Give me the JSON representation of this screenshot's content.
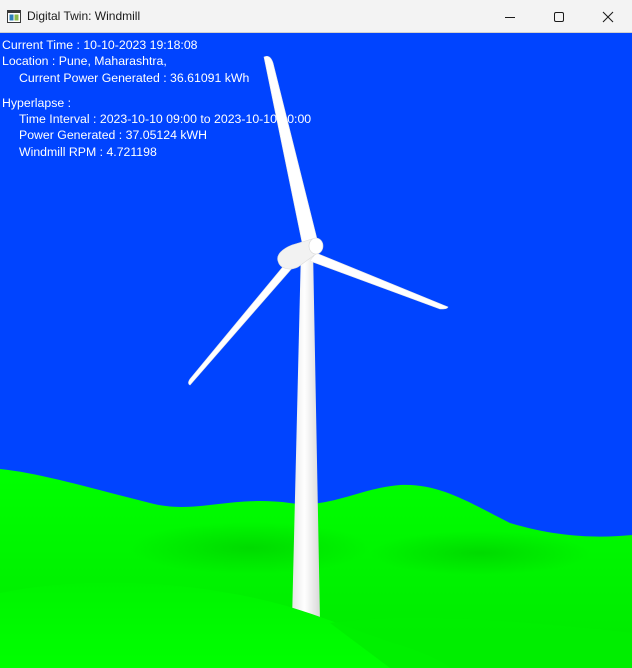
{
  "window": {
    "title": "Digital Twin: Windmill",
    "app_icon": "app-window-icon",
    "controls": {
      "minimize": "minimize-icon",
      "maximize": "maximize-icon",
      "close": "close-icon"
    }
  },
  "scene": {
    "sky_color": "#0044ff",
    "grass_color": "#00ee00",
    "turbine_color": "#ffffff"
  },
  "hud": {
    "current_time": "Current Time : 10-10-2023 19:18:08",
    "location": "Location : Pune, Maharashtra,",
    "current_power": "Current Power Generated : 36.61091 kWh",
    "hyperlapse_heading": "Hyperlapse :",
    "time_interval": "Time Interval : 2023-10-10 09:00 to 2023-10-10 10:00",
    "power_generated": "Power Generated : 37.05124 kWH",
    "windmill_rpm": "Windmill RPM : 4.721198"
  }
}
